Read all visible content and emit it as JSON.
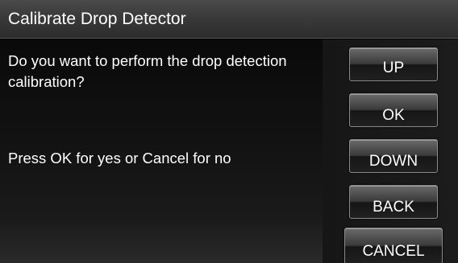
{
  "title_bar": {
    "title": "Calibrate Drop Detector"
  },
  "message": {
    "question": "Do you want to perform the drop detection calibration?",
    "instruction": "Press OK for yes or Cancel for no"
  },
  "buttons": {
    "up": "UP",
    "ok": "OK",
    "down": "DOWN",
    "back": "BACK",
    "cancel": "CANCEL"
  },
  "colors": {
    "background": "#050505",
    "title_bar": "#3a3a3a",
    "text": "#ffffff",
    "button_border": "#8a8a8a"
  }
}
